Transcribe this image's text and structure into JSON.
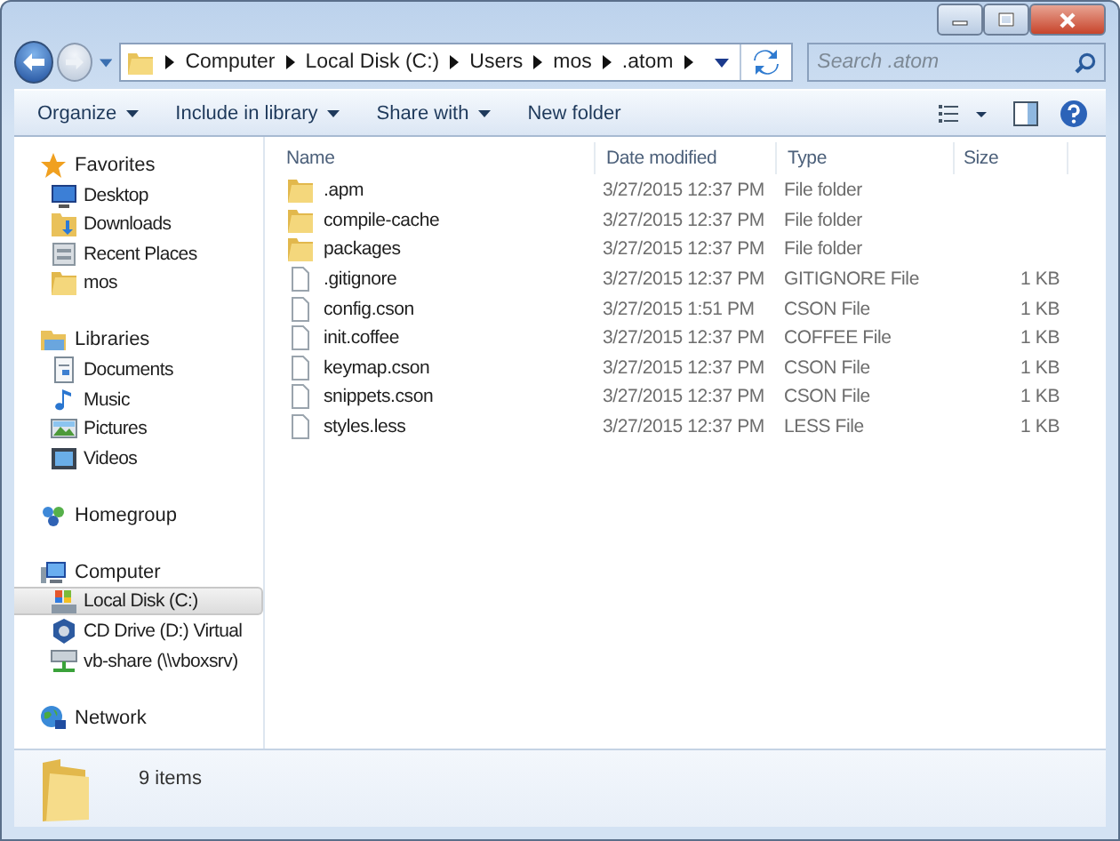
{
  "address_bar": {
    "segments": [
      "Computer",
      "Local Disk (C:)",
      "Users",
      "mos",
      ".atom"
    ]
  },
  "search": {
    "placeholder": "Search .atom"
  },
  "toolbar": {
    "items": [
      {
        "label": "Organize",
        "dropdown": true
      },
      {
        "label": "Include in library",
        "dropdown": true
      },
      {
        "label": "Share with",
        "dropdown": true
      },
      {
        "label": "New folder",
        "dropdown": false
      }
    ]
  },
  "navigation_pane": {
    "groups": [
      {
        "label": "Favorites",
        "kind": "star",
        "items": [
          {
            "label": "Desktop",
            "kind": "desktop",
            "selected": false
          },
          {
            "label": "Downloads",
            "kind": "downloads",
            "selected": false
          },
          {
            "label": "Recent Places",
            "kind": "recent",
            "selected": false
          },
          {
            "label": "mos",
            "kind": "folder",
            "selected": false
          }
        ]
      },
      {
        "label": "Libraries",
        "kind": "library",
        "items": [
          {
            "label": "Documents",
            "kind": "document",
            "selected": false
          },
          {
            "label": "Music",
            "kind": "music",
            "selected": false
          },
          {
            "label": "Pictures",
            "kind": "pictures",
            "selected": false
          },
          {
            "label": "Videos",
            "kind": "video",
            "selected": false
          }
        ]
      },
      {
        "label": "Homegroup",
        "kind": "homegroup"
      },
      {
        "label": "Computer",
        "kind": "computer",
        "items": [
          {
            "label": "Local Disk (C:)",
            "kind": "drive",
            "selected": true
          },
          {
            "label": "CD Drive (D:) Virtual",
            "kind": "cd",
            "selected": false
          },
          {
            "label": "vb-share (\\\\vboxsrv)",
            "kind": "share",
            "selected": false
          }
        ]
      },
      {
        "label": "Network",
        "kind": "network"
      }
    ]
  },
  "file_list": {
    "columns": [
      "Name",
      "Date modified",
      "Type",
      "Size"
    ],
    "rows": [
      {
        "name": ".apm",
        "kind": "folder",
        "date": "3/27/2015 12:37 PM",
        "type": "File folder"
      },
      {
        "name": "compile-cache",
        "kind": "folder",
        "date": "3/27/2015 12:37 PM",
        "type": "File folder"
      },
      {
        "name": "packages",
        "kind": "folder",
        "date": "3/27/2015 12:37 PM",
        "type": "File folder"
      },
      {
        "name": ".gitignore",
        "kind": "file",
        "date": "3/27/2015 12:37 PM",
        "type": "GITIGNORE File",
        "size": "1 KB"
      },
      {
        "name": "config.cson",
        "kind": "file",
        "date": "3/27/2015 1:51 PM",
        "type": "CSON File",
        "size": "1 KB"
      },
      {
        "name": "init.coffee",
        "kind": "file",
        "date": "3/27/2015 12:37 PM",
        "type": "COFFEE File",
        "size": "1 KB"
      },
      {
        "name": "keymap.cson",
        "kind": "file",
        "date": "3/27/2015 12:37 PM",
        "type": "CSON File",
        "size": "1 KB"
      },
      {
        "name": "snippets.cson",
        "kind": "file",
        "date": "3/27/2015 12:37 PM",
        "type": "CSON File",
        "size": "1 KB"
      },
      {
        "name": "styles.less",
        "kind": "file",
        "date": "3/27/2015 12:37 PM",
        "type": "LESS File",
        "size": "1 KB"
      }
    ]
  },
  "status_bar": {
    "item_count": "9 items"
  }
}
